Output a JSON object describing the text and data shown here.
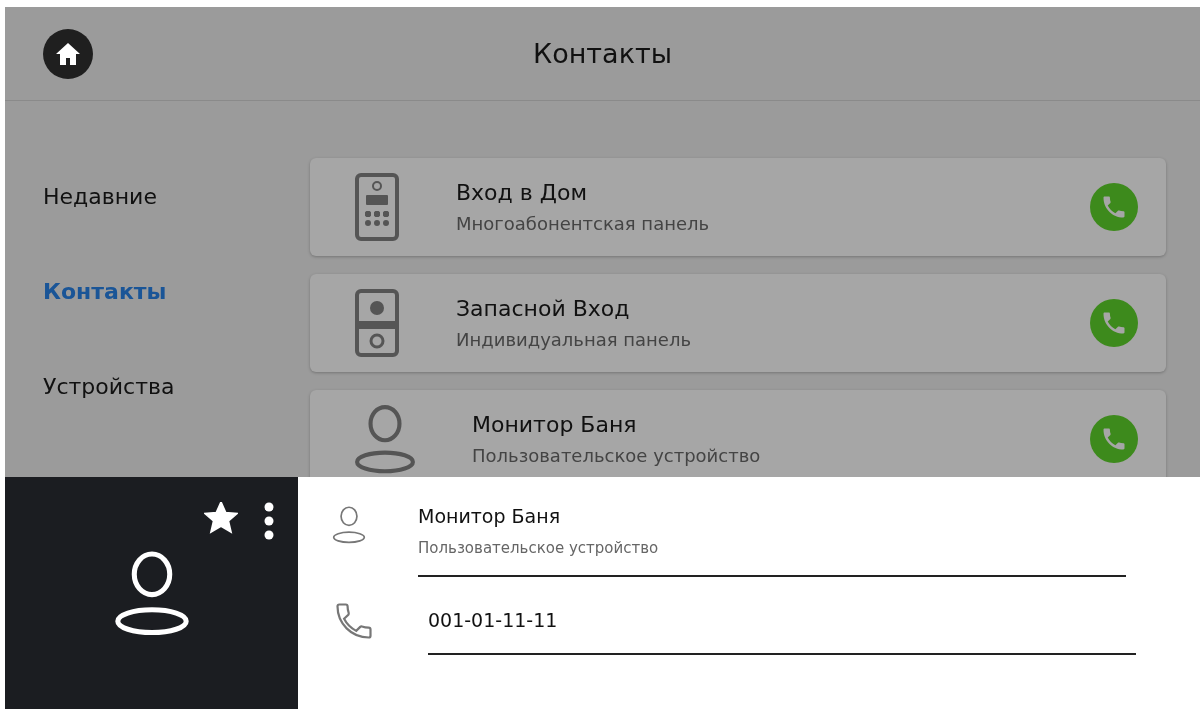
{
  "header": {
    "title": "Контакты"
  },
  "sidebar": {
    "items": [
      {
        "label": "Недавние",
        "selected": false
      },
      {
        "label": "Контакты",
        "selected": true
      },
      {
        "label": "Устройства",
        "selected": false
      }
    ]
  },
  "contacts": [
    {
      "kind": "multi-panel",
      "name": "Вход в Дом",
      "type": "Многоабонентская панель"
    },
    {
      "kind": "single-panel",
      "name": "Запасной Вход",
      "type": "Индивидуальная панель"
    },
    {
      "kind": "user",
      "name": "Монитор Баня",
      "type": "Пользовательское устройство"
    }
  ],
  "details": {
    "favorite": true,
    "fields": [
      {
        "kind": "name",
        "value": "Монитор Баня",
        "caption": "Пользовательское устройство"
      },
      {
        "kind": "phone",
        "value": "001-01-11-11"
      }
    ]
  }
}
